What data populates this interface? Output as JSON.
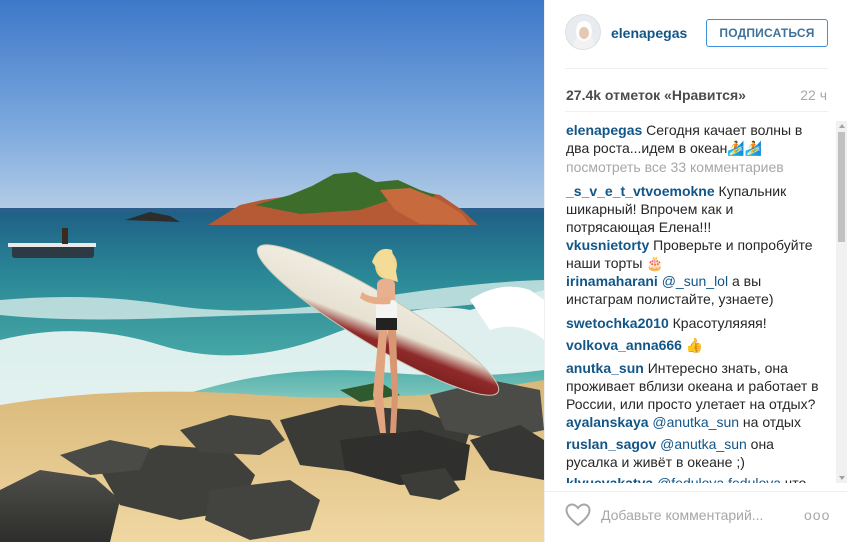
{
  "post": {
    "username": "elenapegas",
    "follow_label": "ПОДПИСАТЬСЯ",
    "likes": "27.4k отметок «Нравится»",
    "time": "22 ч",
    "caption_user": "elenapegas",
    "caption_text": " Сегодня качает волны в два роста...идем в океан🏄🏄",
    "view_all": "посмотреть все 33 комментариев",
    "comment_placeholder": "Добавьте комментарий...",
    "more_label": "ooo"
  },
  "comments": [
    {
      "user": "_s_v_e_t_vtvoemokne",
      "mention": "",
      "text": " Купальник шикарный! Впрочем как и потрясающая Елена!!!"
    },
    {
      "user": "vkusnietorty",
      "mention": "",
      "text": " Проверьте и попробуйте наши торты 🎂"
    },
    {
      "user": "irinamaharani",
      "mention": " @_sun_lol",
      "text": " а вы инстаграм полистайте, узнаете)"
    },
    {
      "user": "swetochka2010",
      "mention": "",
      "text": " Красотуляяяя!"
    },
    {
      "user": "volkova_anna666",
      "mention": "",
      "text": " 👍"
    },
    {
      "user": "anutka_sun",
      "mention": "",
      "text": " Интересно знать, она проживает вблизи океана и работает в России, или просто улетает на отдых?"
    },
    {
      "user": "ayalanskaya",
      "mention": " @anutka_sun",
      "text": " на отдых"
    },
    {
      "user": "ruslan_sagov",
      "mention": " @anutka_sun",
      "text": " она русалка и живёт в океане ;)"
    },
    {
      "user": "klyuevakatya",
      "mention": " @fedulova.fedulova",
      "text": " что за"
    }
  ],
  "colors": {
    "link": "#125688",
    "follow_border": "#4090db",
    "follow_text": "#3f729b",
    "muted": "#a5a7aa",
    "body": "#262626"
  }
}
